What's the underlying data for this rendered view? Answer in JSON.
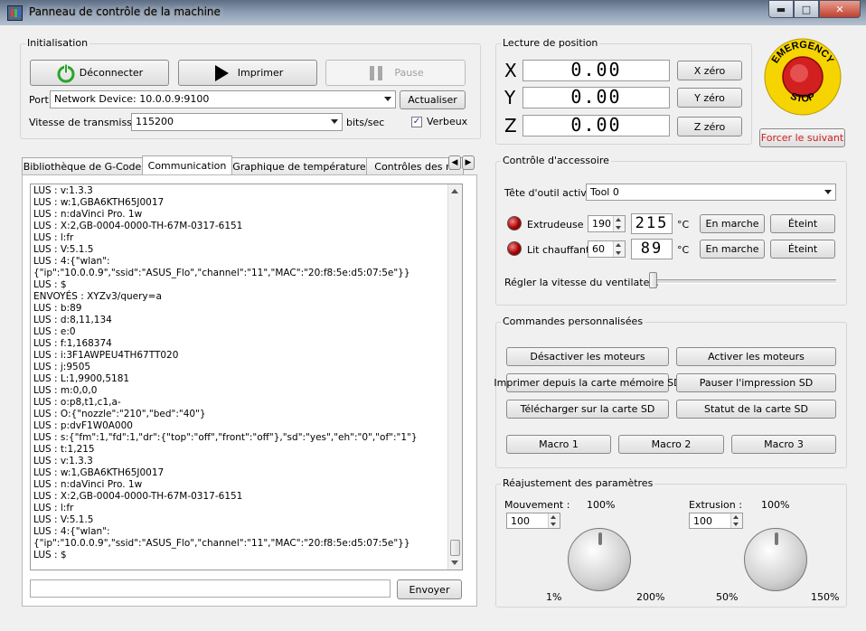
{
  "window": {
    "title": "Panneau de contrôle de la machine",
    "buttons": {
      "minimize": "▬",
      "maximize": "□",
      "close": "✕"
    }
  },
  "init": {
    "title": "Initialisation",
    "disconnect_label": "Déconnecter",
    "print_label": "Imprimer",
    "pause_label": "Pause",
    "port_label": "Port",
    "port_value": "Network Device: 10.0.0.9:9100",
    "refresh_label": "Actualiser",
    "speed_label": "Vitesse de transmission",
    "speed_value": "115200",
    "speed_unit": "bits/sec",
    "verbose_label": "Verbeux",
    "verbose_checked": true
  },
  "tabs": [
    "Bibliothèque de G-Code",
    "Communication",
    "Graphique de température",
    "Contrôles des m"
  ],
  "console": {
    "lines": [
      "LUS : v:1.3.3",
      "LUS : w:1,GBA6KTH65J0017",
      "LUS : n:daVinci Pro. 1w",
      "LUS : X:2,GB-0004-0000-TH-67M-0317-6151",
      "LUS : l:fr",
      "LUS : V:5.1.5",
      "LUS : 4:{\"wlan\":",
      "{\"ip\":\"10.0.0.9\",\"ssid\":\"ASUS_Flo\",\"channel\":\"11\",\"MAC\":\"20:f8:5e:d5:07:5e\"}}",
      "LUS : $",
      "ENVOYÉS : XYZv3/query=a",
      "LUS : b:89",
      "LUS : d:8,11,134",
      "LUS : e:0",
      "LUS : f:1,168374",
      "LUS : i:3F1AWPEU4TH67TT020",
      "LUS : j:9505",
      "LUS : L:1,9900,5181",
      "LUS : m:0,0,0",
      "LUS : o:p8,t1,c1,a-",
      "LUS : O:{\"nozzle\":\"210\",\"bed\":\"40\"}",
      "LUS : p:dvF1W0A000",
      "LUS : s:{\"fm\":1,\"fd\":1,\"dr\":{\"top\":\"off\",\"front\":\"off\"},\"sd\":\"yes\",\"eh\":\"0\",\"of\":\"1\"}",
      "LUS : t:1,215",
      "LUS : v:1.3.3",
      "LUS : w:1,GBA6KTH65J0017",
      "LUS : n:daVinci Pro. 1w",
      "LUS : X:2,GB-0004-0000-TH-67M-0317-6151",
      "LUS : l:fr",
      "LUS : V:5.1.5",
      "LUS : 4:{\"wlan\":",
      "{\"ip\":\"10.0.0.9\",\"ssid\":\"ASUS_Flo\",\"channel\":\"11\",\"MAC\":\"20:f8:5e:d5:07:5e\"}}",
      "LUS : $"
    ],
    "send_label": "Envoyer",
    "input_value": ""
  },
  "position": {
    "title": "Lecture de position",
    "axes": [
      {
        "axis": "X",
        "value": "0.00",
        "zero_label": "X zéro"
      },
      {
        "axis": "Y",
        "value": "0.00",
        "zero_label": "Y zéro"
      },
      {
        "axis": "Z",
        "value": "0.00",
        "zero_label": "Z zéro"
      }
    ],
    "estop_top": "EMERGENCY",
    "estop_bottom": "STOP",
    "force_next_label": "Forcer le suivant"
  },
  "accessory": {
    "title": "Contrôle d'accessoire",
    "tool_label": "Tête d'outil active",
    "tool_value": "Tool 0",
    "extruder": {
      "label": "Extrudeuse",
      "target": "190",
      "current": "215",
      "unit": "°C",
      "on_label": "En marche",
      "off_label": "Éteint"
    },
    "bed": {
      "label": "Lit chauffant",
      "target": "60",
      "current": "89",
      "unit": "°C",
      "on_label": "En marche",
      "off_label": "Éteint"
    },
    "fan_label": "Régler la vitesse du ventilateur",
    "fan_speed": 0
  },
  "custom": {
    "title": "Commandes personnalisées",
    "buttons": [
      "Désactiver les moteurs",
      "Activer les moteurs",
      "Imprimer depuis la carte mémoire SD",
      "Pauser l'impression SD",
      "Télécharger sur la carte SD",
      "Statut de la carte SD"
    ],
    "macros": [
      "Macro 1",
      "Macro 2",
      "Macro 3"
    ]
  },
  "adjust": {
    "title": "Réajustement des paramètres",
    "movement": {
      "label": "Mouvement :",
      "value": "100",
      "pct": "100%",
      "min": "1%",
      "max": "200%"
    },
    "extrusion": {
      "label": "Extrusion :",
      "value": "100",
      "pct": "100%",
      "min": "50%",
      "max": "150%"
    }
  },
  "colors": {
    "accent_red": "#cc2020",
    "estop_yellow": "#f5d400",
    "lcd_digit": "#222222"
  }
}
